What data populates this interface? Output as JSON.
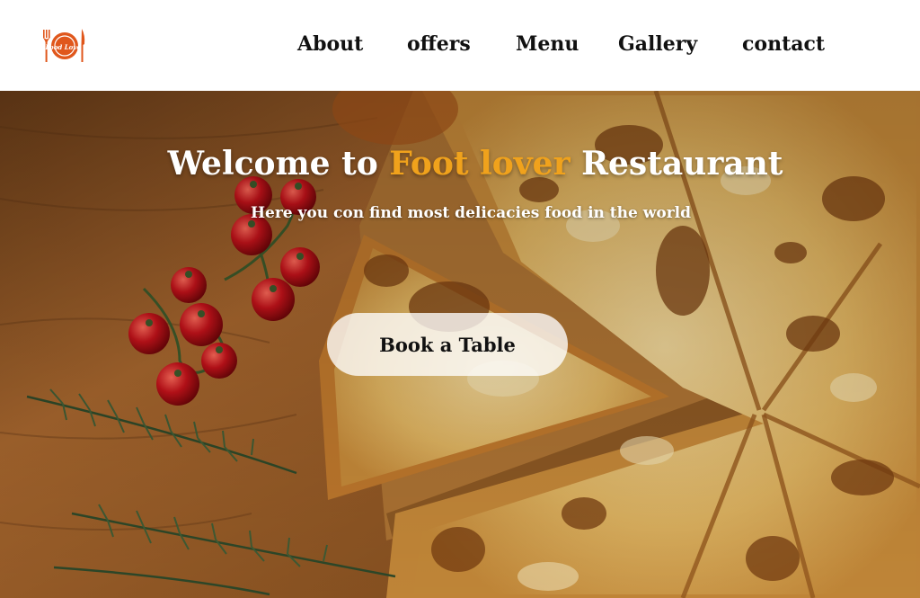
{
  "brand": {
    "logo_text": "Food Lover",
    "logo_color": "#e0571c",
    "logo_icon": "plate-fork-knife-icon"
  },
  "nav": {
    "items": [
      {
        "label": "About"
      },
      {
        "label": "offers"
      },
      {
        "label": "Menu"
      },
      {
        "label": "Gallery"
      },
      {
        "label": "contact"
      }
    ]
  },
  "hero": {
    "title_prefix": "Welcome to",
    "title_accent": "Foot lover",
    "title_suffix": "Restaurant",
    "accent_color": "#f0a21c",
    "subtitle": "Here you con find most delicacies food in the world",
    "cta_label": "Book a Table",
    "background": "pizza-on-wooden-table-photo"
  }
}
